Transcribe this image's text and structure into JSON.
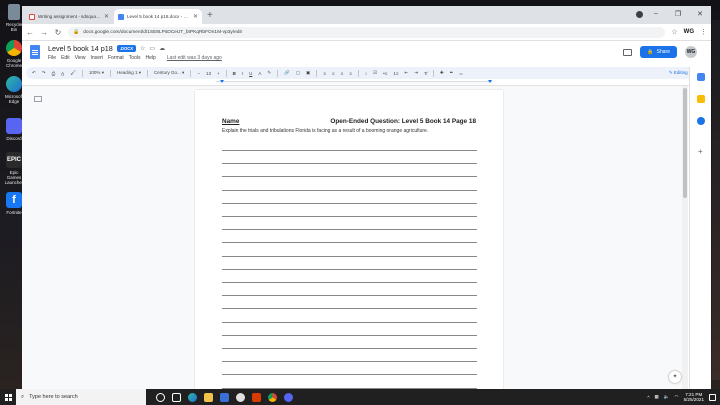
{
  "desktop": {
    "icons": [
      {
        "label": "Recycle Bin"
      },
      {
        "label": "Google Chrome"
      },
      {
        "label": "Microsoft Edge"
      },
      {
        "label": "Discord"
      },
      {
        "label": "Epic Games Launcher"
      },
      {
        "label": "Fortnite"
      }
    ]
  },
  "browser": {
    "tabs": [
      {
        "title": "Writing assignment - sdsquad@...",
        "icon": "gmail-icon"
      },
      {
        "title": "Level 5 book 14 p18.docx - Goo...",
        "icon": "docs-icon"
      }
    ],
    "url": "docs.google.com/document/d/1SE8LPsDCeUT_btPKqRbFOn1M-vp3y/edit",
    "window_controls": [
      "–",
      "❐",
      "✕"
    ],
    "extension_user": "WG"
  },
  "docs": {
    "title": "Level 5 book 14 p18",
    "badge": ".DOCX",
    "menu": [
      "File",
      "Edit",
      "View",
      "Insert",
      "Format",
      "Tools",
      "Help"
    ],
    "last_edit": "Last edit was 3 days ago",
    "share_label": "Share",
    "avatar_initials": "WG",
    "toolbar": {
      "zoom": "100%",
      "style": "Heading 1",
      "font": "Century Go...",
      "font_size": "13",
      "bold": "B",
      "italic": "I",
      "underline": "U",
      "mode": "Editing"
    }
  },
  "document": {
    "name_label": "Name",
    "header_title": "Open-Ended Question: Level 5 Book 14 Page 18",
    "prompt": "Explain the trials and tribulations Florida is facing as a result of a booming orange agriculture.",
    "answer_lines": 21
  },
  "taskbar": {
    "search_placeholder": "Type here to search",
    "time": "7:21 PM",
    "date": "5/25/2021"
  }
}
